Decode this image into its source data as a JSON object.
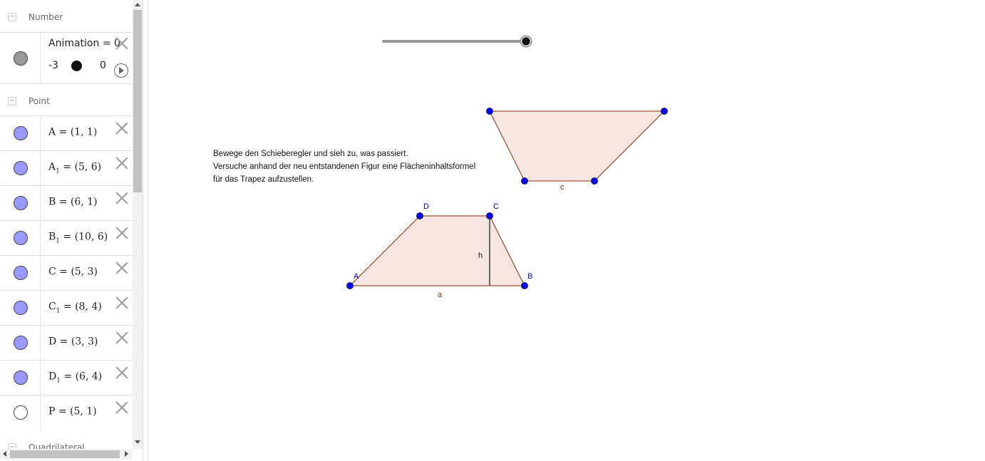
{
  "algebra": {
    "sections": {
      "number": "Number",
      "point": "Point",
      "quadrilateral": "Quadrilateral"
    },
    "slider": {
      "label": "Animation = 0",
      "min": "-3",
      "max": "0",
      "value": 0,
      "marble_color": "#999999"
    },
    "points": [
      {
        "name": "A",
        "sub": "",
        "value": " = (1, 1)"
      },
      {
        "name": "A",
        "sub": "1",
        "value": " = (5, 6)"
      },
      {
        "name": "B",
        "sub": "",
        "value": " = (6, 1)"
      },
      {
        "name": "B",
        "sub": "1",
        "value": " = (10, 6)"
      },
      {
        "name": "C",
        "sub": "",
        "value": " = (5, 3)"
      },
      {
        "name": "C",
        "sub": "1",
        "value": " = (8, 4)"
      },
      {
        "name": "D",
        "sub": "",
        "value": " = (3, 3)"
      },
      {
        "name": "D",
        "sub": "1",
        "value": " = (6, 4)"
      },
      {
        "name": "P",
        "sub": "",
        "value": " = (5, 1)"
      }
    ],
    "point_colors": {
      "visible": "#9999ff",
      "hidden": "#ffffff"
    }
  },
  "graphics": {
    "instructions": [
      "Bewege den Schieberegler und sieh zu, was passiert.",
      "Versuche anhand der neu entstandenen Figur eine Flächeninhaltsformel",
      "für das Trapez aufzustellen."
    ],
    "labels": {
      "A": "A",
      "B": "B",
      "C": "C",
      "D": "D",
      "a": "a",
      "c": "c",
      "h": "h"
    },
    "colors": {
      "fill": "#f5e6e1",
      "stroke": "#8b2a0a",
      "point": "#0000ff",
      "point_label": "#0000cc",
      "segment_label": "#8b2a0a"
    }
  }
}
